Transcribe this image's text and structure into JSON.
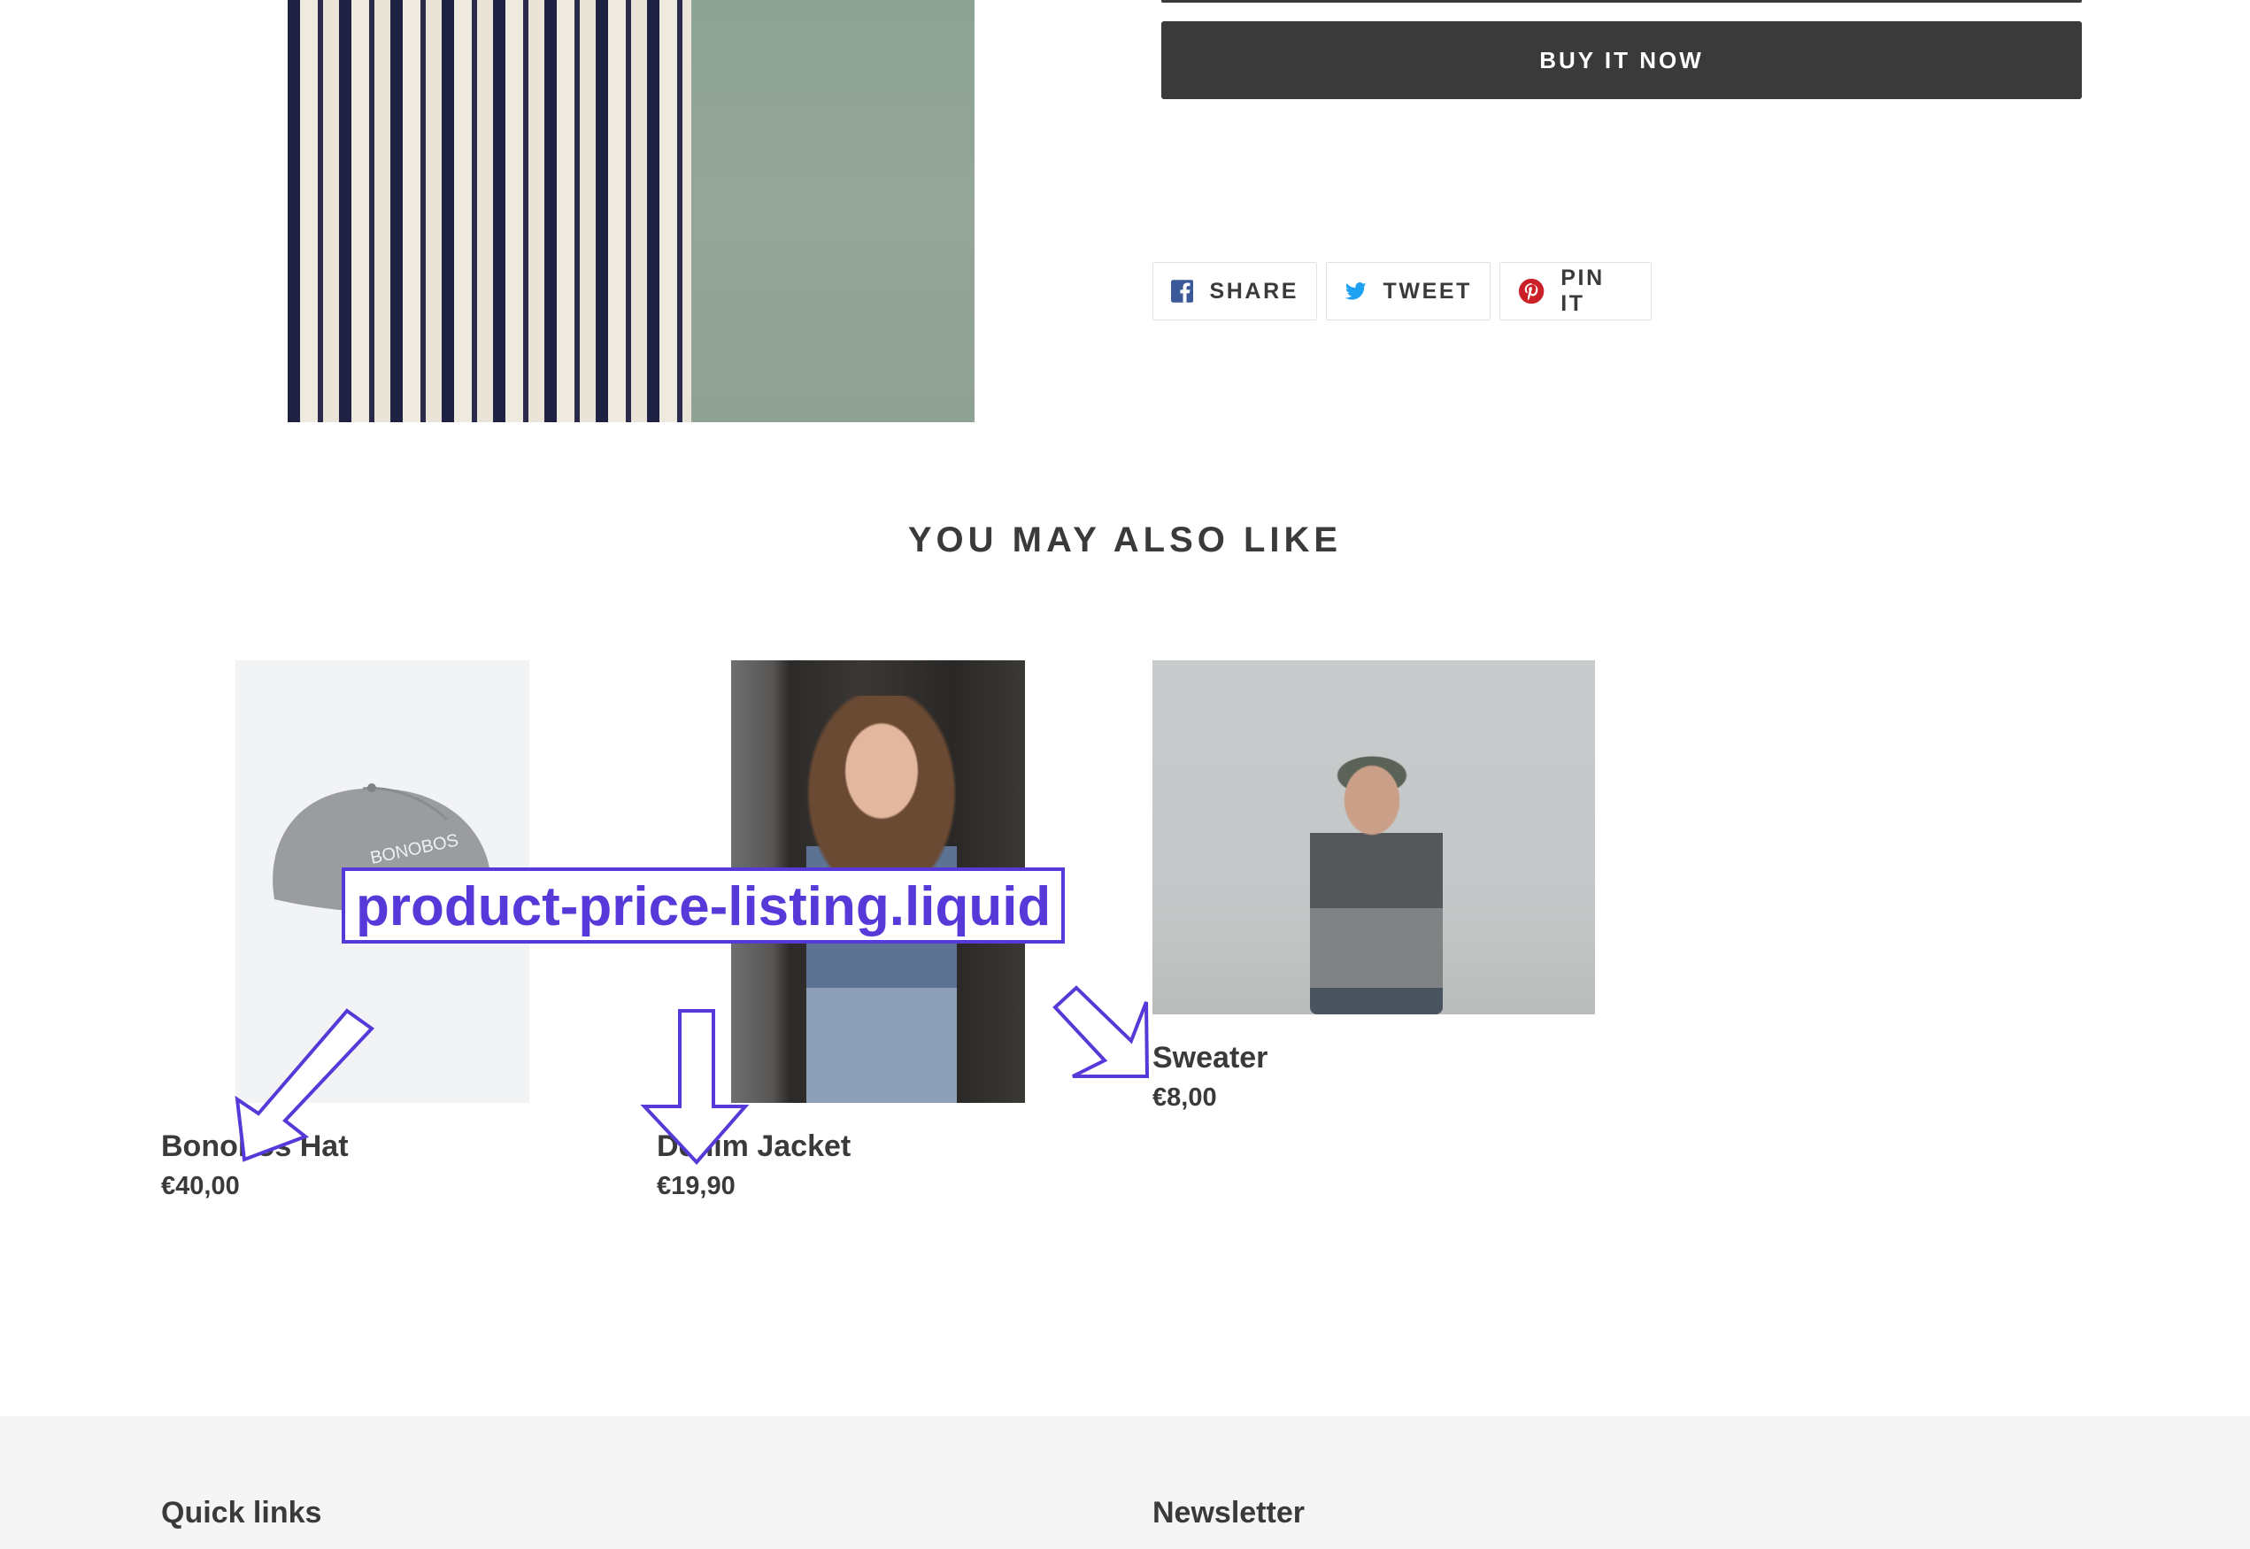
{
  "product": {
    "buy_now_label": "BUY IT NOW"
  },
  "social": {
    "share_label": "SHARE",
    "tweet_label": "TWEET",
    "pin_label": "PIN IT",
    "colors": {
      "facebook": "#3b5998",
      "twitter": "#1da1f2",
      "pinterest": "#cb2027"
    }
  },
  "related": {
    "heading": "YOU MAY ALSO LIKE",
    "items": [
      {
        "title": "Bonobos Hat",
        "price": "€40,00",
        "image": "grey-cap-photo",
        "image_text": "BONOBOS"
      },
      {
        "title": "Denim Jacket",
        "price": "€19,90",
        "image": "woman-denim-jacket-photo"
      },
      {
        "title": "Sweater",
        "price": "€8,00",
        "image": "man-sweater-photo"
      }
    ]
  },
  "annotation": {
    "label": "product-price-listing.liquid",
    "color": "#5639d8"
  },
  "footer": {
    "quick_links_heading": "Quick links",
    "newsletter_heading": "Newsletter"
  },
  "theme": {
    "text": "#3a3a3a",
    "button_bg": "#3a3a3a",
    "footer_bg": "#f5f5f5"
  }
}
